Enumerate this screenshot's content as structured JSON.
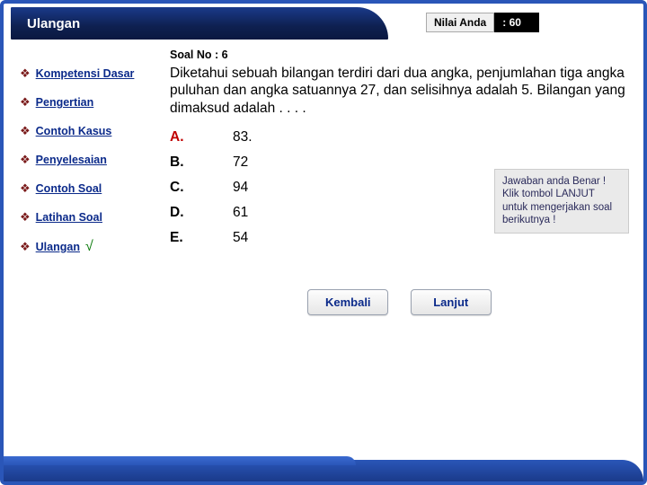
{
  "header": {
    "title": "Ulangan"
  },
  "score": {
    "label": "Nilai Anda",
    "value": ": 60"
  },
  "sidebar": {
    "items": [
      {
        "label": "Kompetensi Dasar"
      },
      {
        "label": "Pengertian"
      },
      {
        "label": "Contoh Kasus"
      },
      {
        "label": "Penyelesaian"
      },
      {
        "label": "Contoh Soal"
      },
      {
        "label": "Latihan Soal"
      },
      {
        "label": "Ulangan",
        "checked": true
      }
    ],
    "check_mark": "√"
  },
  "question": {
    "number_label": "Soal No : 6",
    "text": "Diketahui sebuah bilangan terdiri dari dua angka, penjumlahan tiga angka puluhan\ndan angka satuannya 27, dan selisihnya adalah 5. Bilangan yang dimaksud adalah . . . .",
    "options": [
      {
        "letter": "A.",
        "value": "83.",
        "selected": true
      },
      {
        "letter": "B.",
        "value": "72"
      },
      {
        "letter": "C.",
        "value": "94"
      },
      {
        "letter": "D.",
        "value": "61"
      },
      {
        "letter": "E.",
        "value": "54"
      }
    ]
  },
  "feedback": {
    "text": "Jawaban anda Benar ! Klik tombol LANJUT untuk mengerjakan soal berikutnya !"
  },
  "buttons": {
    "back": "Kembali",
    "next": "Lanjut"
  }
}
